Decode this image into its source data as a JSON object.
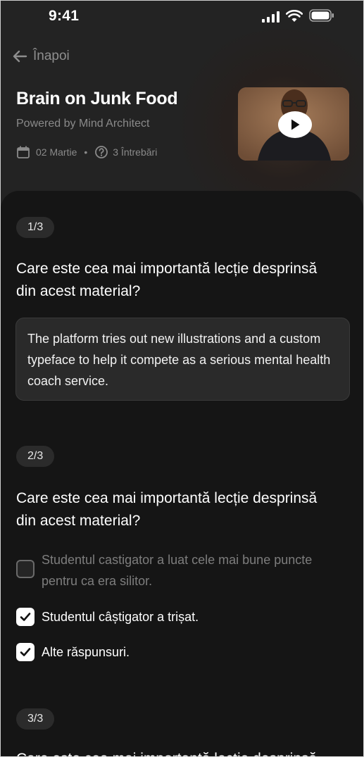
{
  "status_bar": {
    "time": "9:41"
  },
  "nav": {
    "back_label": "Înapoi"
  },
  "header": {
    "title": "Brain on Junk Food",
    "subtitle": "Powered by Mind Architect",
    "date": "02 Martie",
    "separator": "•",
    "questions_count": "3 Întrebări"
  },
  "questions": [
    {
      "badge": "1/3",
      "text": "Care este cea mai importantă lecție desprinsă din acest material?",
      "answer": "The platform tries out new illustrations and a custom typeface to help it compete as a serious mental health coach service."
    },
    {
      "badge": "2/3",
      "text": "Care este cea mai importantă lecție desprinsă din acest material?",
      "options": [
        {
          "label": "Studentul castigator a luat cele mai bune puncte pentru ca era silitor.",
          "checked": false
        },
        {
          "label": "Studentul câștigator a trișat.",
          "checked": true
        },
        {
          "label": "Alte răspunsuri.",
          "checked": true
        }
      ]
    },
    {
      "badge": "3/3",
      "text": "Care este cea mai importantă lecție desprinsă din acest material?"
    }
  ],
  "colors": {
    "background": "#232323",
    "card": "#151515",
    "muted_text": "#8a8a8a"
  },
  "icons": {
    "back": "arrow-left-icon",
    "calendar": "calendar-icon",
    "help": "question-circle-icon",
    "play": "play-icon",
    "check": "check-icon"
  }
}
